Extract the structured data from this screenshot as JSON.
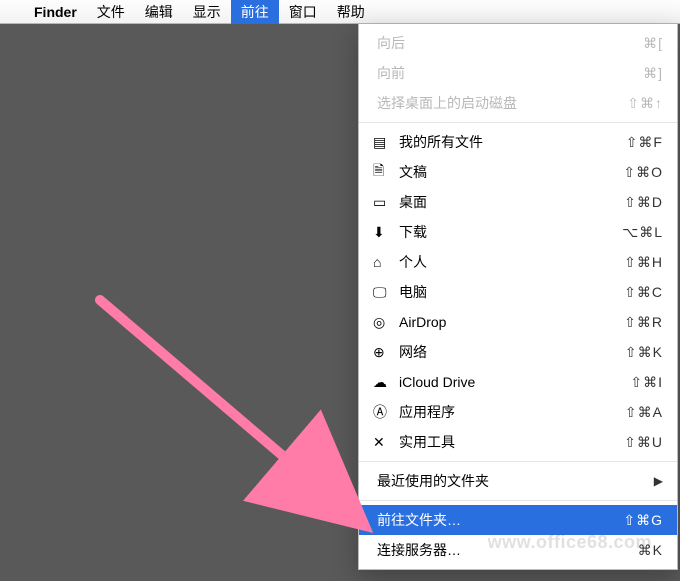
{
  "menubar": {
    "apple": "",
    "app": "Finder",
    "items": [
      "文件",
      "编辑",
      "显示",
      "前往",
      "窗口",
      "帮助"
    ],
    "active_index": 3
  },
  "dropdown": {
    "disabled": [
      {
        "label": "向后",
        "shortcut": "⌘["
      },
      {
        "label": "向前",
        "shortcut": "⌘]"
      },
      {
        "label": "选择桌面上的启动磁盘",
        "shortcut": "⇧⌘↑"
      }
    ],
    "nav": [
      {
        "icon": "allfiles-icon",
        "label": "我的所有文件",
        "shortcut": "⇧⌘F"
      },
      {
        "icon": "documents-icon",
        "label": "文稿",
        "shortcut": "⇧⌘O"
      },
      {
        "icon": "desktop-icon",
        "label": "桌面",
        "shortcut": "⇧⌘D"
      },
      {
        "icon": "downloads-icon",
        "label": "下载",
        "shortcut": "⌥⌘L"
      },
      {
        "icon": "home-icon",
        "label": "个人",
        "shortcut": "⇧⌘H"
      },
      {
        "icon": "computer-icon",
        "label": "电脑",
        "shortcut": "⇧⌘C"
      },
      {
        "icon": "airdrop-icon",
        "label": "AirDrop",
        "shortcut": "⇧⌘R"
      },
      {
        "icon": "network-icon",
        "label": "网络",
        "shortcut": "⇧⌘K"
      },
      {
        "icon": "icloud-icon",
        "label": "iCloud Drive",
        "shortcut": "⇧⌘I"
      },
      {
        "icon": "applications-icon",
        "label": "应用程序",
        "shortcut": "⇧⌘A"
      },
      {
        "icon": "utilities-icon",
        "label": "实用工具",
        "shortcut": "⇧⌘U"
      }
    ],
    "recent": {
      "label": "最近使用的文件夹"
    },
    "gotofolder": {
      "label": "前往文件夹…",
      "shortcut": "⇧⌘G"
    },
    "connect": {
      "label": "连接服务器…",
      "shortcut": "⌘K"
    }
  },
  "watermark": "www.office68.com"
}
